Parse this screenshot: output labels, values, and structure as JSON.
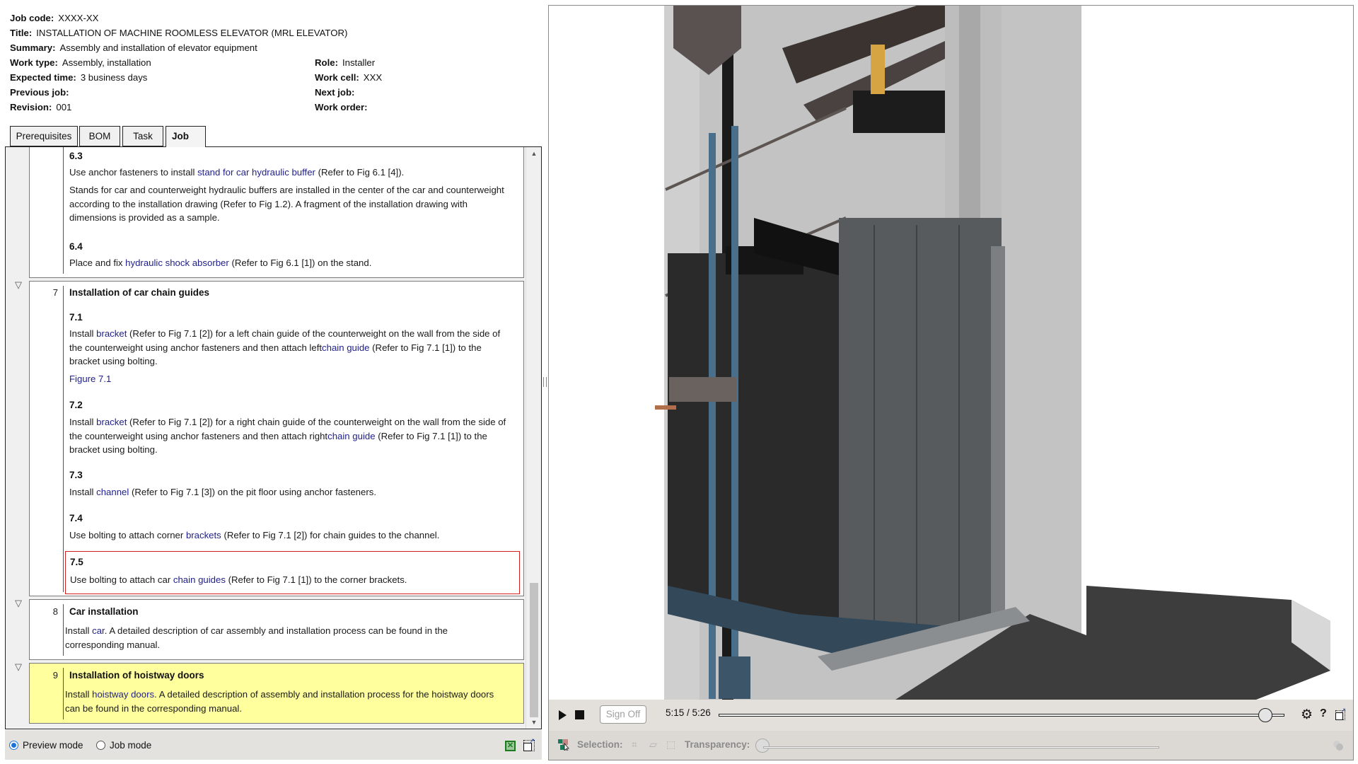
{
  "header": {
    "rows_left": [
      {
        "label": "Job code:",
        "value": "XXXX-XX"
      },
      {
        "label": "Title:",
        "value": "INSTALLATION OF MACHINE ROOMLESS ELEVATOR (MRL ELEVATOR)"
      },
      {
        "label": "Summary:",
        "value": "Assembly and installation of elevator equipment"
      },
      {
        "label": "Work type:",
        "value": "Assembly, installation"
      },
      {
        "label": "Expected time:",
        "value": "3 business days"
      },
      {
        "label": "Previous job:",
        "value": ""
      },
      {
        "label": "Revision:",
        "value": "001"
      }
    ],
    "rows_right": [
      {
        "label": "Role:",
        "value": "Installer"
      },
      {
        "label": "Work cell:",
        "value": "XXX"
      },
      {
        "label": "Next job:",
        "value": ""
      },
      {
        "label": "Work order:",
        "value": ""
      }
    ]
  },
  "tabs": [
    {
      "label": "Prerequisites",
      "active": false
    },
    {
      "label": "BOM",
      "active": false
    },
    {
      "label": "Task",
      "active": false
    },
    {
      "label": "Job",
      "active": true
    }
  ],
  "steps": {
    "s6": {
      "sub3": {
        "num": "6.3",
        "p1": {
          "pre": "Use anchor fasteners to install ",
          "link": "stand for car hydraulic buffer",
          "post": " (Refer to Fig 6.1 [4])."
        },
        "p2": "Stands for car and counterweight hydraulic buffers are installed in the center of the car and counterweight according to the installation drawing (Refer to Fig 1.2). A fragment of the installation drawing with dimensions is provided as a sample."
      },
      "sub4": {
        "num": "6.4",
        "p1": {
          "pre": "Place and fix ",
          "link": "hydraulic shock absorber",
          "post": " (Refer to Fig 6.1 [1]) on the stand."
        }
      }
    },
    "s7": {
      "num": "7",
      "title": "Installation of car chain guides",
      "sub1": {
        "num": "7.1",
        "pre": "Install ",
        "link1": "bracket",
        "mid": " (Refer to Fig 7.1 [2]) for a left chain guide of the counterweight on the wall from the side of the counterweight using anchor fasteners and then attach left",
        "link2": "chain guide",
        "post": " (Refer to Fig 7.1 [1]) to the bracket using bolting.",
        "figure": "Figure 7.1"
      },
      "sub2": {
        "num": "7.2",
        "pre": "Install ",
        "link1": "bracket",
        "mid": " (Refer to Fig 7.1 [2]) for a right chain guide of the counterweight on the wall from the side of the counterweight using anchor fasteners and then attach right",
        "link2": "chain guide",
        "post": " (Refer to Fig 7.1 [1]) to the bracket using bolting."
      },
      "sub3": {
        "num": "7.3",
        "pre": "Install ",
        "link": "channel",
        "post": " (Refer to Fig 7.1 [3]) on the pit floor using anchor fasteners."
      },
      "sub4": {
        "num": "7.4",
        "pre": "Use bolting to attach corner ",
        "link": "brackets",
        "post": " (Refer to Fig 7.1 [2]) for chain guides to the channel."
      },
      "sub5": {
        "num": "7.5",
        "pre": "Use bolting to attach car ",
        "link": "chain guides",
        "post": " (Refer to Fig 7.1 [1]) to the corner brackets.",
        "selected": true
      }
    },
    "s8": {
      "num": "8",
      "title": "Car installation",
      "pre": "Install ",
      "link": "car",
      "post": ". A detailed description of car assembly and installation process can be found in the corresponding manual."
    },
    "s9": {
      "num": "9",
      "title": "Installation of hoistway doors",
      "pre": "Install ",
      "link": "hoistway doors",
      "post": ". A detailed description of assembly and installation process for the hoistway doors can be found in the corresponding manual.",
      "highlighted": true
    }
  },
  "scroll": {
    "position_fraction": 0.78
  },
  "footer": {
    "modes": [
      {
        "label": "Preview mode",
        "selected": true
      },
      {
        "label": "Job mode",
        "selected": false
      }
    ]
  },
  "player": {
    "sign_off_label": "Sign Off",
    "current_time": "5:15",
    "total_time": "5:26",
    "time_text": "5:15 / 5:26",
    "progress_fraction": 0.968,
    "help_label": "?"
  },
  "toolbar": {
    "selection_label": "Selection:",
    "transparency_label": "Transparency:",
    "transparency_fraction": 0.0
  },
  "colors": {
    "link": "#1f1f8a",
    "highlight_bg": "#ffff9e",
    "selection_border": "#d62020",
    "radio_accent": "#1a73d9"
  }
}
